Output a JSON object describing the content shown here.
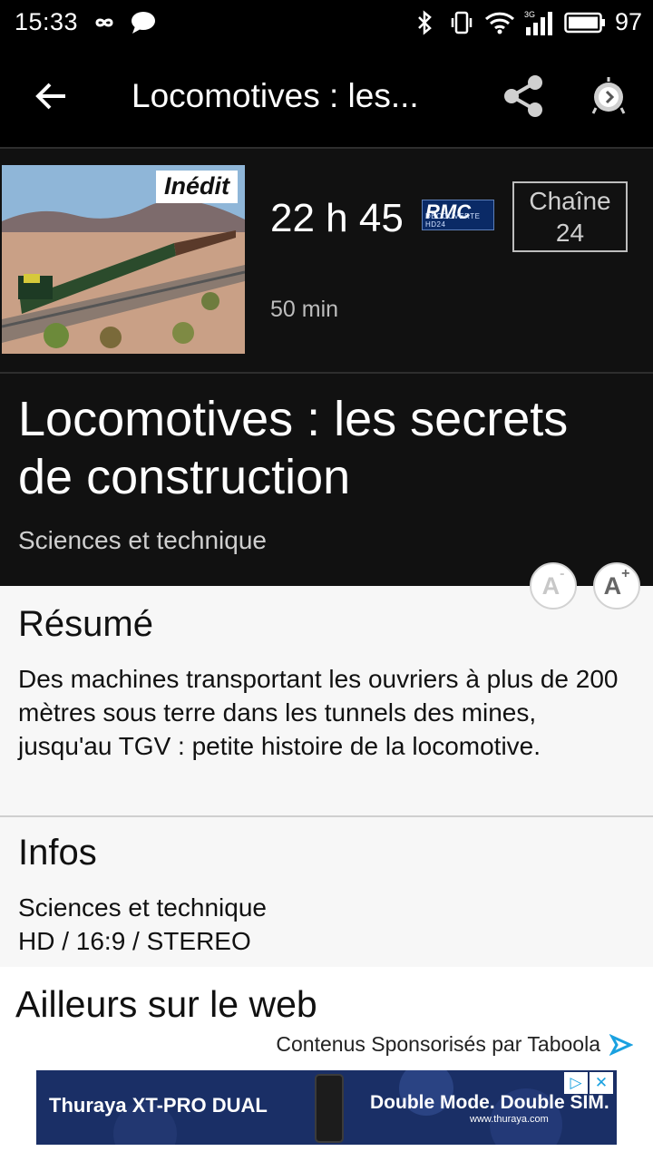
{
  "status_bar": {
    "time": "15:33",
    "battery_level": "97",
    "network_type": "3G"
  },
  "app_bar": {
    "title": "Locomotives : les..."
  },
  "program": {
    "badge": "Inédit",
    "air_time": "22 h 45",
    "channel_logo_text": "RMC",
    "channel_logo_subtext": "DÉCOUVERTE HD24",
    "channel_label": "Chaîne",
    "channel_number": "24",
    "duration": "50 min",
    "title": "Locomotives : les secrets de construction",
    "genre": "Sciences et technique"
  },
  "font_controls": {
    "decrease_label": "A-",
    "increase_label": "A+"
  },
  "summary": {
    "heading": "Résumé",
    "text": "Des machines transportant les ouvriers à plus de 200 mètres sous terre dans les tunnels des mines, jusqu'au TGV : petite histoire de la locomotive."
  },
  "infos": {
    "heading": "Infos",
    "line1": "Sciences et technique",
    "line2": "HD / 16:9 / STEREO"
  },
  "web": {
    "heading": "Ailleurs sur le web",
    "sponsor_text": "Contenus Sponsorisés par Taboola",
    "ad_left_text": "Thuraya XT-PRO DUAL",
    "ad_right_text": "Double Mode. Double SIM.",
    "ad_url": "www.thuraya.com"
  },
  "colors": {
    "background_dark": "#111111",
    "background_light": "#f7f7f7",
    "accent_ad": "#1a2f66",
    "taboola": "#1aa1e0"
  }
}
